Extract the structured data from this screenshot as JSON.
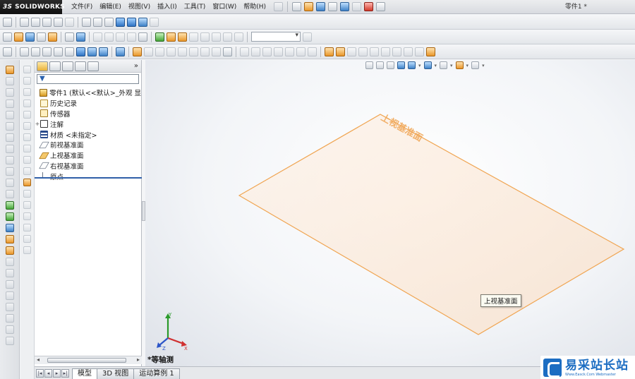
{
  "app": {
    "brand": "SOLIDWORKS",
    "brand_prefix": "3S",
    "document_title": "零件1 *"
  },
  "menu": {
    "items": [
      "文件(F)",
      "编辑(E)",
      "视图(V)",
      "插入(I)",
      "工具(T)",
      "窗口(W)",
      "帮助(H)"
    ]
  },
  "feature_manager": {
    "tabs": [
      "featuremanager-tab",
      "propertymanager-tab",
      "configuration-tab",
      "dimxpert-tab",
      "display-tab"
    ],
    "expand_label": "»",
    "filter_icon": "funnel-icon",
    "tree": [
      {
        "label": "零件1 (默认<<默认>_外观 显",
        "icon": "part-icon",
        "expander": ""
      },
      {
        "label": "历史记录",
        "icon": "history-icon",
        "expander": ""
      },
      {
        "label": "传感器",
        "icon": "sensor-icon",
        "expander": ""
      },
      {
        "label": "注解",
        "icon": "annotation-icon",
        "expander": "+"
      },
      {
        "label": "材质 <未指定>",
        "icon": "material-icon",
        "expander": ""
      },
      {
        "label": "前视基准面",
        "icon": "plane-icon",
        "expander": ""
      },
      {
        "label": "上视基准面",
        "icon": "plane-icon",
        "expander": "",
        "selected": true
      },
      {
        "label": "右视基准面",
        "icon": "plane-icon",
        "expander": ""
      },
      {
        "label": "原点",
        "icon": "origin-icon",
        "expander": ""
      }
    ]
  },
  "bottom_tabs": {
    "items": [
      "模型",
      "3D 视图",
      "运动算例 1"
    ],
    "active": "模型"
  },
  "graphics": {
    "plane_label": "上视基准面",
    "tooltip": "上视基准面",
    "view_name": "*等轴测",
    "triad_axes": [
      "X",
      "Y",
      "Z"
    ],
    "plane_color": "#f0a552"
  },
  "watermark": {
    "text": "易采站长站",
    "subtext": "Www.Easck.Com Webmaster"
  }
}
